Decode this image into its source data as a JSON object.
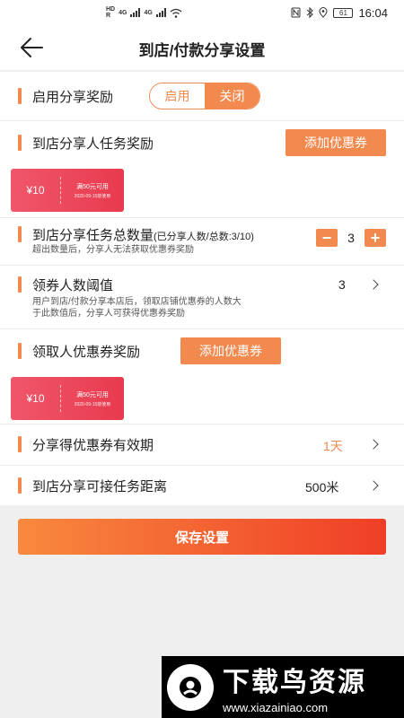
{
  "status_bar": {
    "tag_top": "HD",
    "tag_bottom": "R",
    "net1": "4G",
    "net2": "4G",
    "battery": "61",
    "time": "16:04"
  },
  "header": {
    "title": "到店/付款分享设置"
  },
  "reward_toggle": {
    "label": "启用分享奖励",
    "on": "启用",
    "off": "关闭"
  },
  "task_reward": {
    "label": "到店分享人任务奖励",
    "add_button": "添加优惠券"
  },
  "coupon1": {
    "value": "¥10",
    "condition": "满50元可用",
    "date": "2020-09-15前使用"
  },
  "task_count": {
    "label": "到店分享任务总数量",
    "sub": "(已分享人数/总数:3/10)",
    "hint": "超出数量后，分享人无法获取优惠券奖励",
    "value": "3",
    "minus": "−",
    "plus": "+"
  },
  "threshold": {
    "label": "领券人数阈值",
    "value": "3",
    "hint_line1": "用户到店/付款分享本店后，领取店铺优惠券的人数大",
    "hint_line2": "于此数值后，分享人可获得优惠券奖励"
  },
  "receiver_reward": {
    "label": "领取人优惠券奖励",
    "add_button": "添加优惠券"
  },
  "coupon2": {
    "value": "¥10",
    "condition": "满50元可用",
    "date": "2020-09-15前使用"
  },
  "validity": {
    "label": "分享得优惠券有效期",
    "value": "1天",
    "value_color": "#f28a4f"
  },
  "distance": {
    "label": "到店分享可接任务距离",
    "value": "500米"
  },
  "save_button": "保存设置",
  "watermark": {
    "name": "下载鸟资源",
    "url": "www.xiazainiao.com"
  }
}
